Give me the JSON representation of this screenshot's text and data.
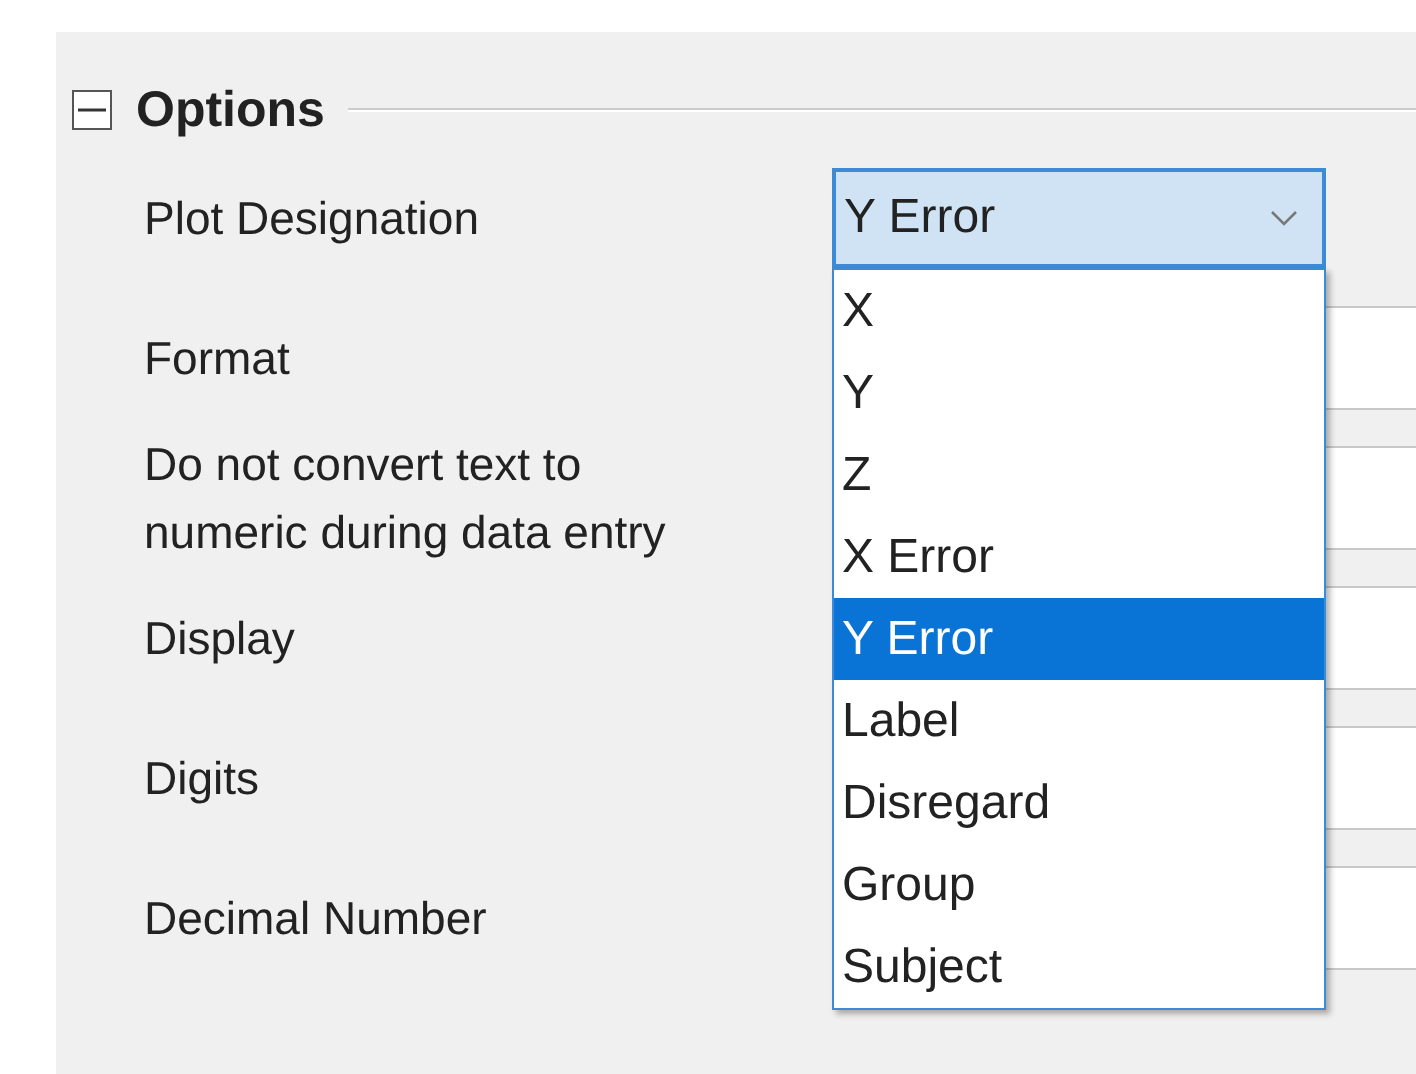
{
  "section": {
    "title": "Options",
    "expanded": true
  },
  "rows": [
    {
      "label": "Plot Designation",
      "kind": "dropdown",
      "value": "Y Error",
      "open": true
    },
    {
      "label": "Format",
      "kind": "field"
    },
    {
      "label": "Do not convert text to numeric during data entry",
      "kind": "field"
    },
    {
      "label": "Display",
      "kind": "field"
    },
    {
      "label": "Digits",
      "kind": "field"
    },
    {
      "label": "Decimal Number",
      "kind": "field"
    }
  ],
  "dropdown_list": [
    {
      "label": "X",
      "selected": false
    },
    {
      "label": "Y",
      "selected": false
    },
    {
      "label": "Z",
      "selected": false
    },
    {
      "label": "X Error",
      "selected": false
    },
    {
      "label": "Y Error",
      "selected": true
    },
    {
      "label": "Label",
      "selected": false
    },
    {
      "label": "Disregard",
      "selected": false
    },
    {
      "label": "Group",
      "selected": false
    },
    {
      "label": "Subject",
      "selected": false
    }
  ]
}
